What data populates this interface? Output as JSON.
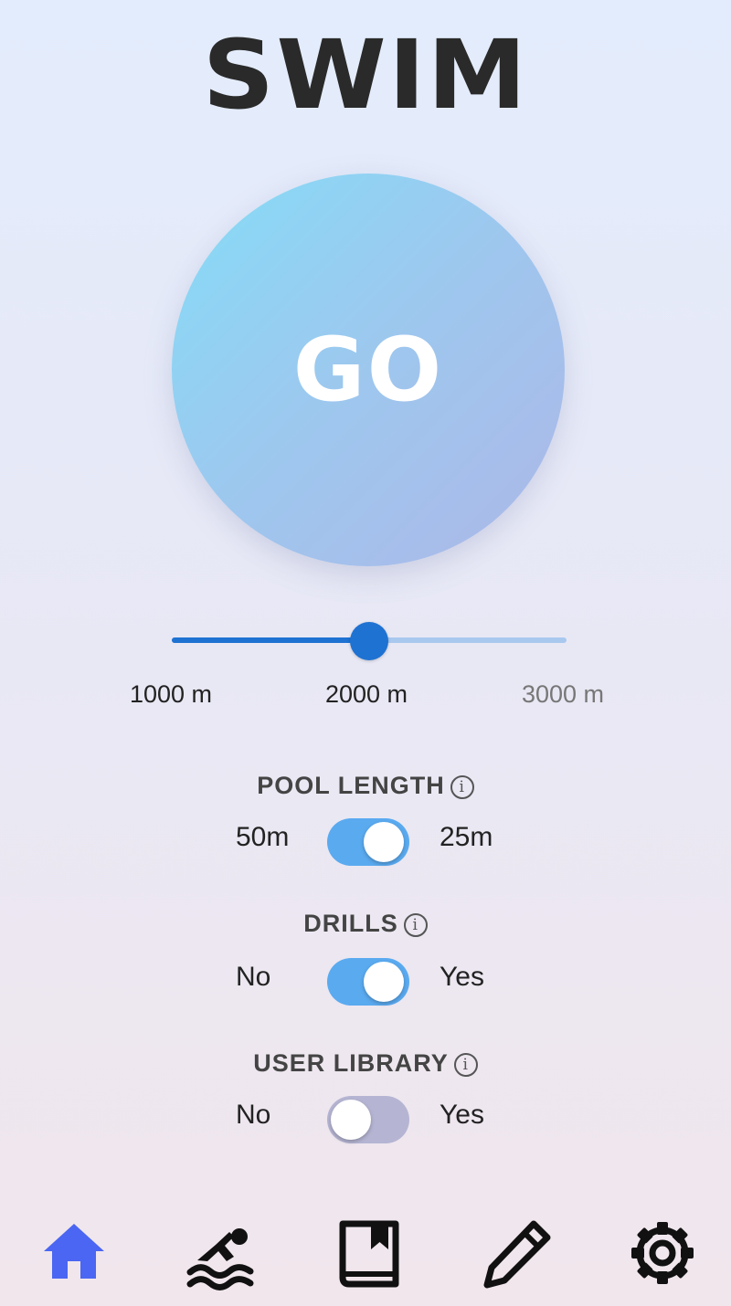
{
  "app": {
    "title": "SWIM"
  },
  "go_button": {
    "label": "GO"
  },
  "distance_slider": {
    "min": 1000,
    "max": 3000,
    "value": 2000,
    "unit": "m",
    "labels": [
      "1000 m",
      "2000 m",
      "3000 m"
    ]
  },
  "settings": {
    "pool_length": {
      "title": "POOL LENGTH",
      "left": "50m",
      "right": "25m",
      "state": "right"
    },
    "drills": {
      "title": "DRILLS",
      "left": "No",
      "right": "Yes",
      "state": "right"
    },
    "user_library": {
      "title": "USER LIBRARY",
      "left": "No",
      "right": "Yes",
      "state": "left"
    }
  },
  "info_glyph": "i",
  "nav": {
    "items": [
      {
        "icon": "home-icon",
        "active": true
      },
      {
        "icon": "swimmer-icon",
        "active": false
      },
      {
        "icon": "book-icon",
        "active": false
      },
      {
        "icon": "pencil-icon",
        "active": false
      },
      {
        "icon": "gear-icon",
        "active": false
      }
    ],
    "active_color": "#4a66f2",
    "icon_color": "#111111"
  },
  "colors": {
    "toggle_on": "#5aaaf0",
    "toggle_off": "#b5b5d3",
    "slider_fill": "#1e72d2",
    "slider_track": "#a9c8ee"
  }
}
